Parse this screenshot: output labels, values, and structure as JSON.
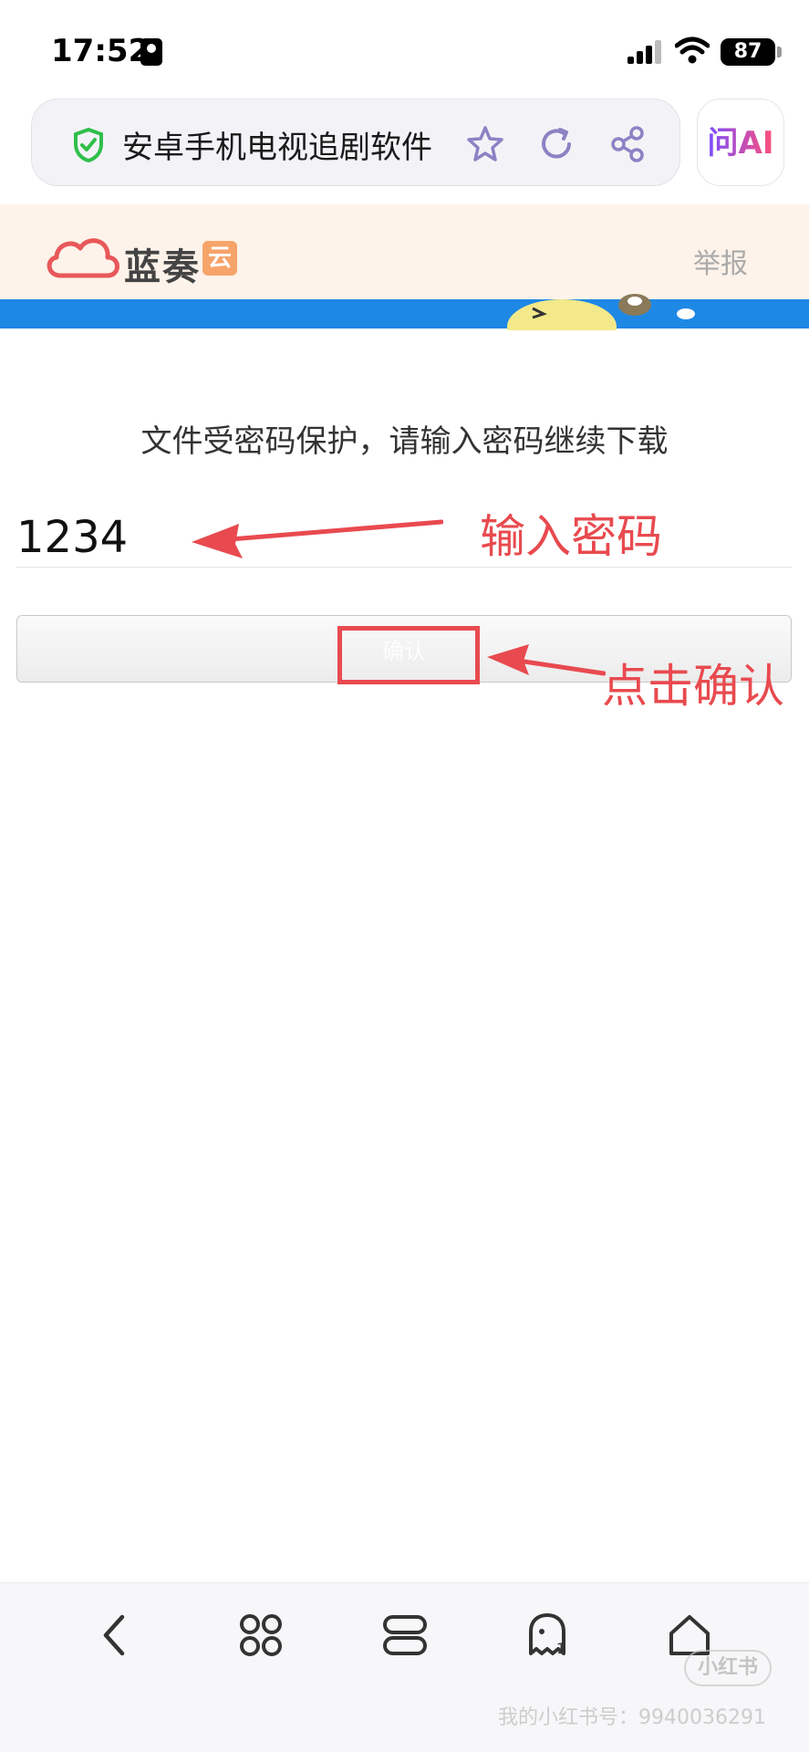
{
  "status_bar": {
    "time": "17:52",
    "battery": "87"
  },
  "browser": {
    "page_title": "安卓手机电视追剧软件",
    "ai_label": "问AI"
  },
  "site": {
    "logo_text": "蓝奏",
    "logo_badge": "云",
    "report_label": "举报"
  },
  "content": {
    "prompt": "文件受密码保护，请输入密码继续下载",
    "password_value": "1234",
    "confirm_label": "确认"
  },
  "annotations": {
    "input_hint": "输入密码",
    "click_hint": "点击确认"
  },
  "nav": {
    "icons": [
      "back-icon",
      "apps-icon",
      "tabs-icon",
      "ghost-icon",
      "home-icon"
    ]
  },
  "watermark": {
    "badge": "小红书",
    "text": "我的小红书号：9940036291"
  },
  "colors": {
    "annotation": "#e84a4f",
    "banner": "#1e88e5",
    "header_bg": "#fdf3ea",
    "shield": "#2fbf4a"
  }
}
